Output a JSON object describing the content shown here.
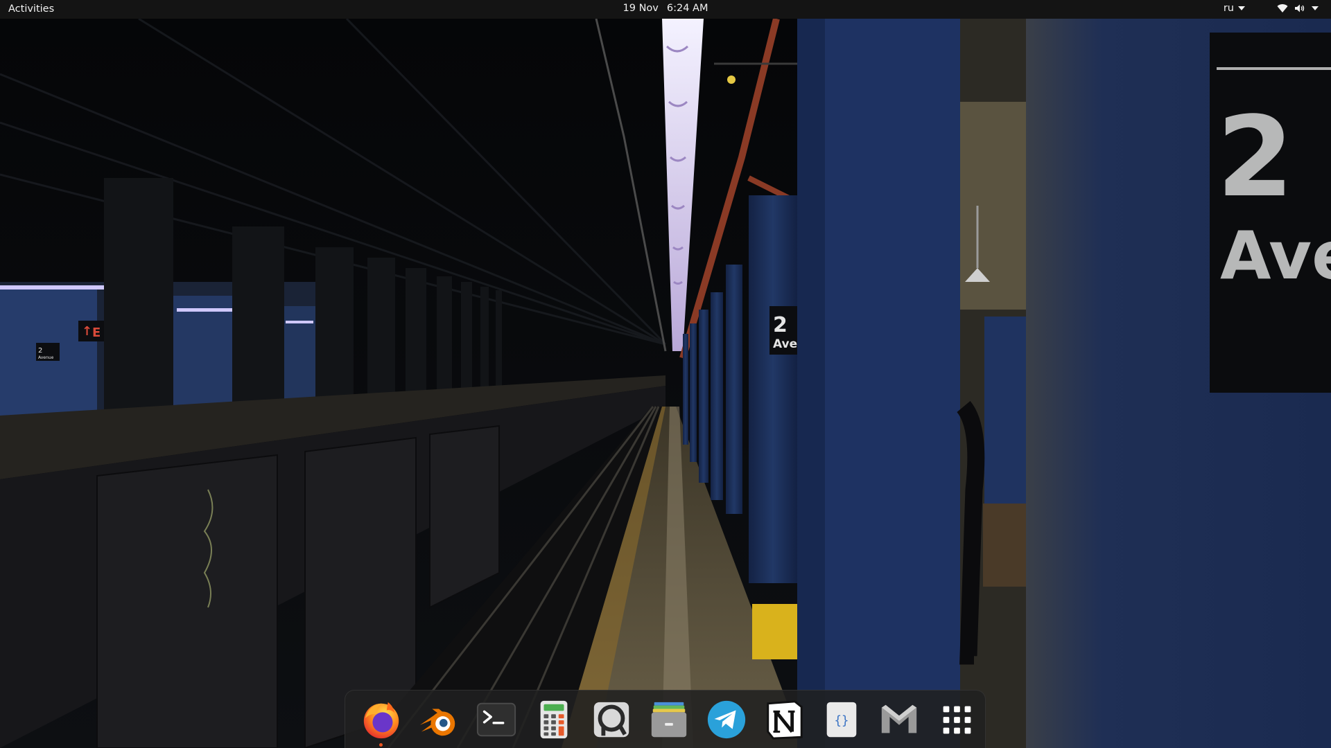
{
  "topbar": {
    "activities_label": "Activities",
    "date": "19 Nov",
    "time": "6:24 AM",
    "language": "ru",
    "icons": [
      "wifi-icon",
      "volume-icon",
      "system-menu-arrow-icon"
    ]
  },
  "wallpaper": {
    "sign_left_number": "2",
    "sign_left_text": "Avenue",
    "sign_mid_number": "2",
    "sign_mid_text": "Ave",
    "sign_big_number": "2",
    "sign_big_text": "Ave",
    "exit_sign": "E"
  },
  "dock": {
    "items": [
      {
        "name": "firefox-icon",
        "running": true
      },
      {
        "name": "blender-icon",
        "running": false
      },
      {
        "name": "terminal-icon",
        "running": false
      },
      {
        "name": "calculator-icon",
        "running": false
      },
      {
        "name": "obs-icon",
        "running": false
      },
      {
        "name": "archive-manager-icon",
        "running": false
      },
      {
        "name": "telegram-icon",
        "running": false
      },
      {
        "name": "notion-icon",
        "running": false
      },
      {
        "name": "code-editor-icon",
        "running": false
      },
      {
        "name": "gmail-icon",
        "running": false
      },
      {
        "name": "show-applications-icon",
        "running": false
      }
    ]
  },
  "colors": {
    "topbar_bg": "#141414",
    "dock_bg": "#202020",
    "running_indicator": "#e95420",
    "pillar_blue": "#1c2f58"
  }
}
